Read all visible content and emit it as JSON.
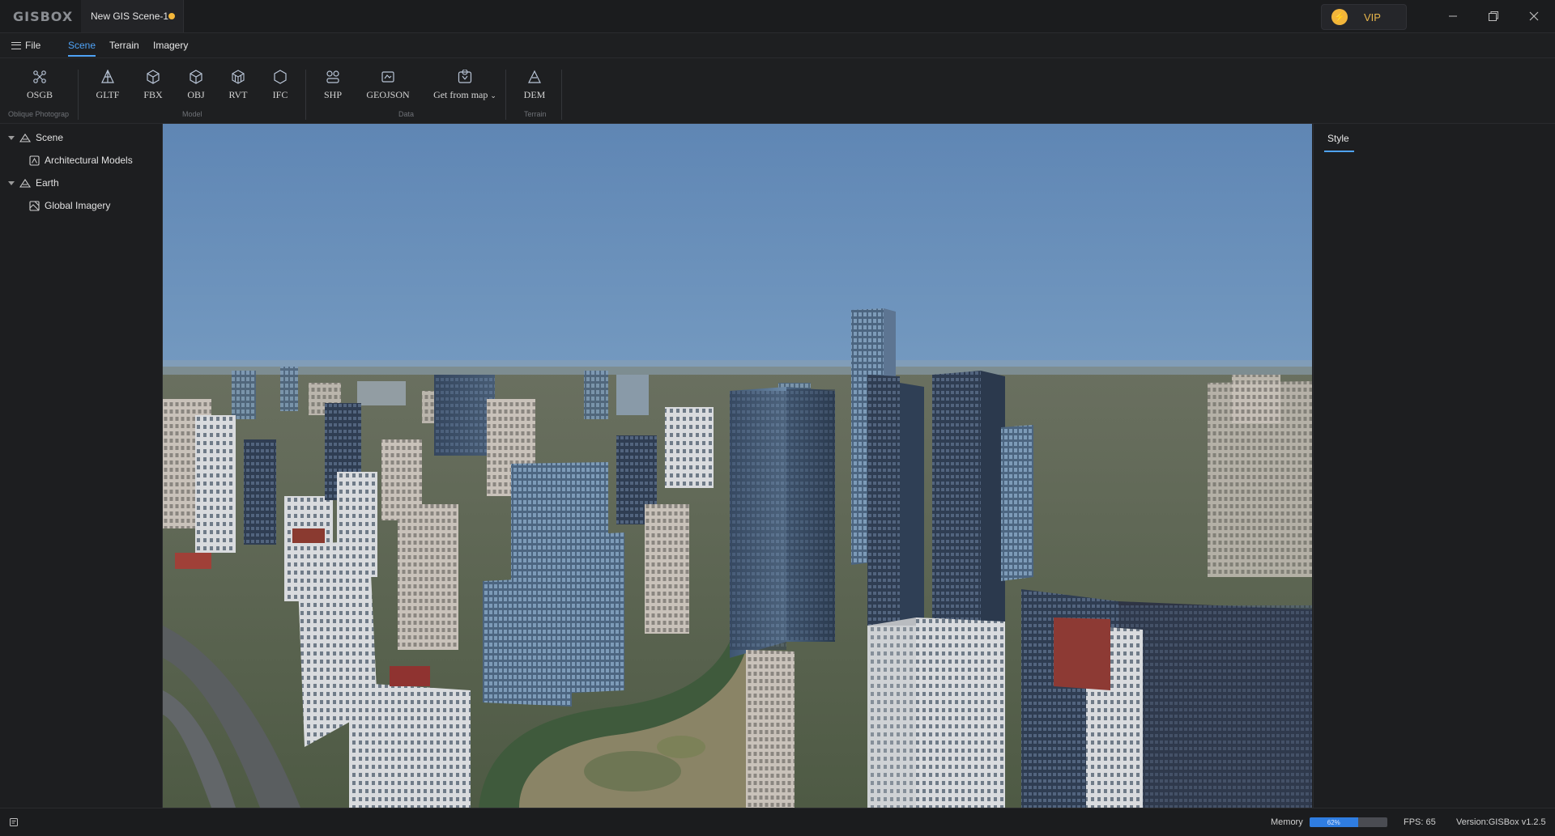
{
  "app": {
    "logo": "GISBOX",
    "tab_title": "New GIS Scene-1"
  },
  "vip": {
    "label": "VIP"
  },
  "menu": {
    "file": "File",
    "tabs": [
      "Scene",
      "Terrain",
      "Imagery"
    ]
  },
  "ribbon": {
    "tools": [
      "OSGB",
      "GLTF",
      "FBX",
      "OBJ",
      "RVT",
      "IFC",
      "SHP",
      "GEOJSON",
      "Get from map",
      "DEM"
    ],
    "groups": {
      "oblique": "Oblique Photograp",
      "model": "Model",
      "data": "Data",
      "terrain": "Terrain"
    }
  },
  "tree": {
    "scene": "Scene",
    "architectural_models": "Architectural Models",
    "earth": "Earth",
    "global_imagery": "Global Imagery"
  },
  "right_panel": {
    "tab": "Style"
  },
  "status": {
    "memory_label": "Memory",
    "memory_percent": 62,
    "memory_text": "62%",
    "fps": "FPS: 65",
    "version": "Version:GISBox v1.2.5"
  },
  "colors": {
    "accent": "#4fa3f7",
    "vip": "#f2b53b",
    "memory": "#2f7de1"
  }
}
